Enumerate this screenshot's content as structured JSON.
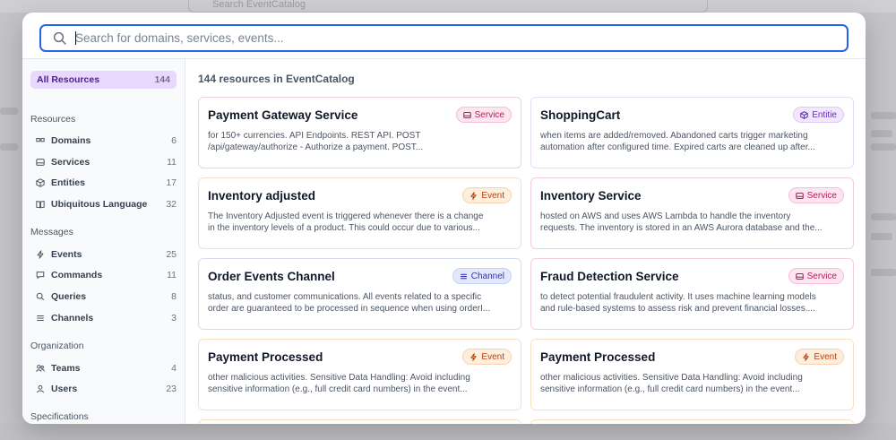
{
  "background": {
    "search_placeholder": "Search EventCatalog"
  },
  "search": {
    "placeholder": "Search for domains, services, events..."
  },
  "sidebar": {
    "all_resources": {
      "label": "All Resources",
      "count": "144"
    },
    "sections": [
      {
        "title": "Resources",
        "items": [
          {
            "label": "Domains",
            "count": "6",
            "icon": "domain-icon"
          },
          {
            "label": "Services",
            "count": "11",
            "icon": "server-icon"
          },
          {
            "label": "Entities",
            "count": "17",
            "icon": "cube-icon"
          },
          {
            "label": "Ubiquitous Language",
            "count": "32",
            "icon": "book-icon"
          }
        ]
      },
      {
        "title": "Messages",
        "items": [
          {
            "label": "Events",
            "count": "25",
            "icon": "bolt-icon"
          },
          {
            "label": "Commands",
            "count": "11",
            "icon": "chat-icon"
          },
          {
            "label": "Queries",
            "count": "8",
            "icon": "search-icon"
          },
          {
            "label": "Channels",
            "count": "3",
            "icon": "channel-icon"
          }
        ]
      },
      {
        "title": "Organization",
        "items": [
          {
            "label": "Teams",
            "count": "4",
            "icon": "team-icon"
          },
          {
            "label": "Users",
            "count": "23",
            "icon": "user-icon"
          }
        ]
      },
      {
        "title": "Specifications",
        "items": []
      }
    ]
  },
  "main": {
    "results_title": "144 resources in EventCatalog",
    "cards": [
      {
        "title": "Payment Gateway Service",
        "badge": "Service",
        "badge_icon": "server-icon",
        "line1": "for 150+ currencies. API Endpoints. REST API. POST",
        "line2": "/api/gateway/authorize - Authorize a payment. POST..."
      },
      {
        "title": "ShoppingCart",
        "badge": "Entitie",
        "badge_icon": "cube-icon",
        "line1": "when items are added/removed. Abandoned carts trigger marketing",
        "line2": "automation after configured time. Expired carts are cleaned up after..."
      },
      {
        "title": "Inventory adjusted",
        "badge": "Event",
        "badge_icon": "bolt-icon",
        "line1": "The Inventory Adjusted event is triggered whenever there is a change",
        "line2": "in the inventory levels of a product. This could occur due to various..."
      },
      {
        "title": "Inventory Service",
        "badge": "Service",
        "badge_icon": "server-icon",
        "line1": "hosted on AWS and uses AWS Lambda to handle the inventory",
        "line2": "requests. The inventory is stored in an AWS Aurora database and the..."
      },
      {
        "title": "Order Events Channel",
        "badge": "Channel",
        "badge_icon": "channel-icon",
        "line1": "status, and customer communications. All events related to a specific",
        "line2": "order are guaranteed to be processed in sequence when using orderI..."
      },
      {
        "title": "Fraud Detection Service",
        "badge": "Service",
        "badge_icon": "server-icon",
        "line1": "to detect potential fraudulent activity. It uses machine learning models",
        "line2": "and rule-based systems to assess risk and prevent financial losses...."
      },
      {
        "title": "Payment Processed",
        "badge": "Event",
        "badge_icon": "bolt-icon",
        "line1": "other malicious activities. Sensitive Data Handling: Avoid including",
        "line2": "sensitive information (e.g., full credit card numbers) in the event..."
      },
      {
        "title": "Payment Processed",
        "badge": "Event",
        "badge_icon": "bolt-icon",
        "line1": "other malicious activities. Sensitive Data Handling: Avoid including",
        "line2": "sensitive information (e.g., full credit card numbers) in the event..."
      }
    ]
  }
}
